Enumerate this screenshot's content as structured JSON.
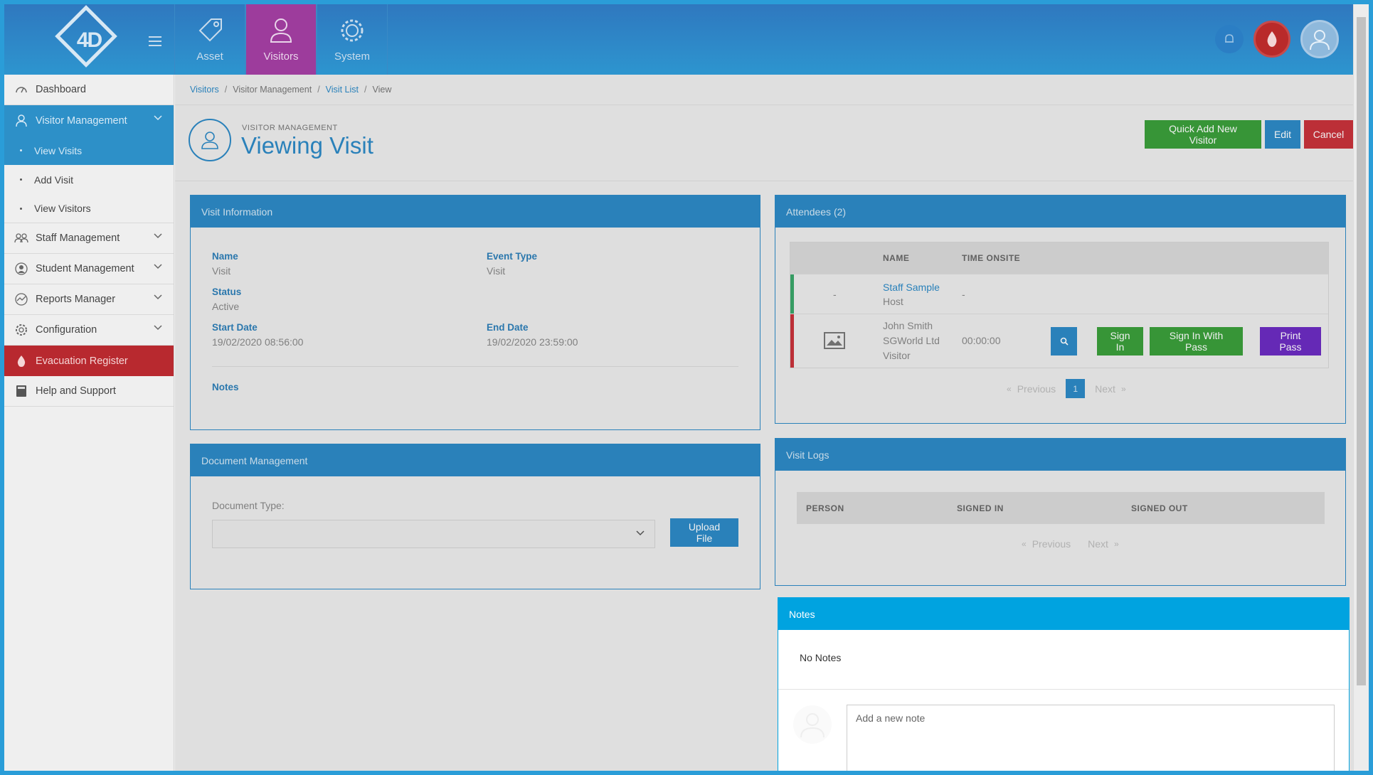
{
  "topbar": {
    "logo_text": "4D",
    "nav": [
      {
        "label": "Asset",
        "icon": "tag-icon"
      },
      {
        "label": "Visitors",
        "icon": "user-icon"
      },
      {
        "label": "System",
        "icon": "gear-icon"
      }
    ]
  },
  "sidebar": {
    "items": [
      {
        "label": "Dashboard",
        "icon": "dashboard-icon"
      },
      {
        "label": "Visitor Management",
        "icon": "user-icon"
      },
      {
        "label": "View Visits"
      },
      {
        "label": "Add Visit"
      },
      {
        "label": "View Visitors"
      },
      {
        "label": "Staff Management",
        "icon": "group-icon"
      },
      {
        "label": "Student Management",
        "icon": "student-icon"
      },
      {
        "label": "Reports Manager",
        "icon": "chart-icon"
      },
      {
        "label": "Configuration",
        "icon": "gear-icon"
      },
      {
        "label": "Evacuation Register",
        "icon": "fire-icon"
      },
      {
        "label": "Help and Support",
        "icon": "book-icon"
      }
    ]
  },
  "breadcrumb": [
    "Visitors",
    "/",
    "Visitor Management",
    "/",
    "Visit List",
    "/",
    "View"
  ],
  "page": {
    "sup": "VISITOR MANAGEMENT",
    "title": "Viewing Visit",
    "buttons": {
      "quick_add": "Quick Add New Visitor",
      "edit": "Edit",
      "cancel": "Cancel"
    }
  },
  "visit_info": {
    "title": "Visit Information",
    "name_label": "Name",
    "name_value": "Visit",
    "event_type_label": "Event Type",
    "event_type_value": "Visit",
    "status_label": "Status",
    "status_value": "Active",
    "start_label": "Start Date",
    "start_value": "19/02/2020 08:56:00",
    "end_label": "End Date",
    "end_value": "19/02/2020 23:59:00",
    "notes_label": "Notes"
  },
  "documents": {
    "title": "Document Management",
    "type_label": "Document Type:",
    "upload": "Upload File"
  },
  "attendees": {
    "title": "Attendees (2)",
    "col_name": "NAME",
    "col_time": "TIME ONSITE",
    "rows": [
      {
        "photo": "-",
        "name": "Staff Sample",
        "role": "Host",
        "time": "-"
      },
      {
        "name": "John Smith",
        "company": "SGWorld Ltd",
        "role": "Visitor",
        "time": "00:00:00",
        "sign_in": "Sign In",
        "sign_in_pass": "Sign In With Pass",
        "print_pass": "Print Pass"
      }
    ],
    "prev": "Previous",
    "next": "Next",
    "page": "1",
    "laquo": "«",
    "raquo": "»"
  },
  "logs": {
    "title": "Visit Logs",
    "col_person": "PERSON",
    "col_in": "SIGNED IN",
    "col_out": "SIGNED OUT",
    "prev": "Previous",
    "next": "Next",
    "laquo": "«",
    "raquo": "»"
  },
  "notes": {
    "title": "Notes",
    "empty": "No Notes",
    "placeholder": "Add a new note"
  },
  "colors": {
    "primary": "#2d8ac6",
    "green": "#3b9f3b",
    "red": "#c8323b",
    "purple": "#6c2cc2",
    "notes": "#00a3e0"
  }
}
